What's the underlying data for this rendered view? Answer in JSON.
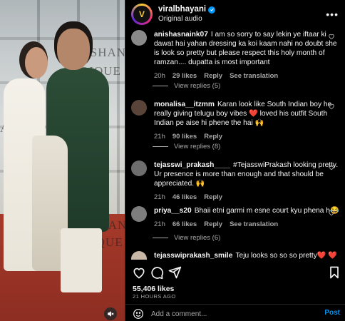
{
  "post": {
    "username": "viralbhayani",
    "audio": "Original audio",
    "more_label": "•••",
    "avatar_letter": "V"
  },
  "photo": {
    "brand_1": "EESHAN",
    "brand_2": "DIQUE",
    "brand_3": "SHAN",
    "brand_4": "IQUE",
    "brand_5": "AB"
  },
  "comments": [
    {
      "username": "anishasnaink07",
      "text": "I am so sorry to say lekin ye iftaar ki dawat hai yahan dressing ka koi kaam nahi no doubt she is look so pretty but please respect this holy month of ramzan.... dupatta is most important",
      "time": "20h",
      "likes": "29 likes",
      "reply": "Reply",
      "extra": "See translation",
      "view_replies": "View replies (5)",
      "avatar_color": "#8a8a8a"
    },
    {
      "username": "monalisa__itzmm",
      "text": "Karan look like South Indian boy he really giving telugu boy vibes ❤️ loved his outfit South Indian pe aise hi phene the hai 🙌",
      "time": "21h",
      "likes": "90 likes",
      "reply": "Reply",
      "extra": "",
      "view_replies": "View replies (8)",
      "avatar_color": "#5a4338"
    },
    {
      "username": "tejasswi_prakash____",
      "text": "#TejasswiPrakash looking pretty. Ur presence is more than enough and that should be appreciated. 🙌",
      "time": "21h",
      "likes": "46 likes",
      "reply": "Reply",
      "extra": "",
      "view_replies": "",
      "avatar_color": "#6e6e6e"
    },
    {
      "username": "priya__s20",
      "text": "Bhaii etni garmi m esne court kyu phena h😂",
      "time": "21h",
      "likes": "66 likes",
      "reply": "Reply",
      "extra": "See translation",
      "view_replies": "View replies (6)",
      "avatar_color": "#7d7d7d"
    },
    {
      "username": "tejasswiprakash_smile",
      "text": "Teju looks so so so pretty❤️ ❤️ 🧿",
      "time": "",
      "likes": "",
      "reply": "",
      "extra": "",
      "view_replies": "",
      "avatar_color": "#c8b7a6"
    }
  ],
  "footer": {
    "likes": "55,406 likes",
    "time_ago": "21 HOURS AGO",
    "comment_placeholder": "Add a comment...",
    "post_label": "Post"
  },
  "colors": {
    "accent": "#0095f6",
    "heart": "#ed4956",
    "muted": "#a8a8a8",
    "background": "#000000"
  }
}
